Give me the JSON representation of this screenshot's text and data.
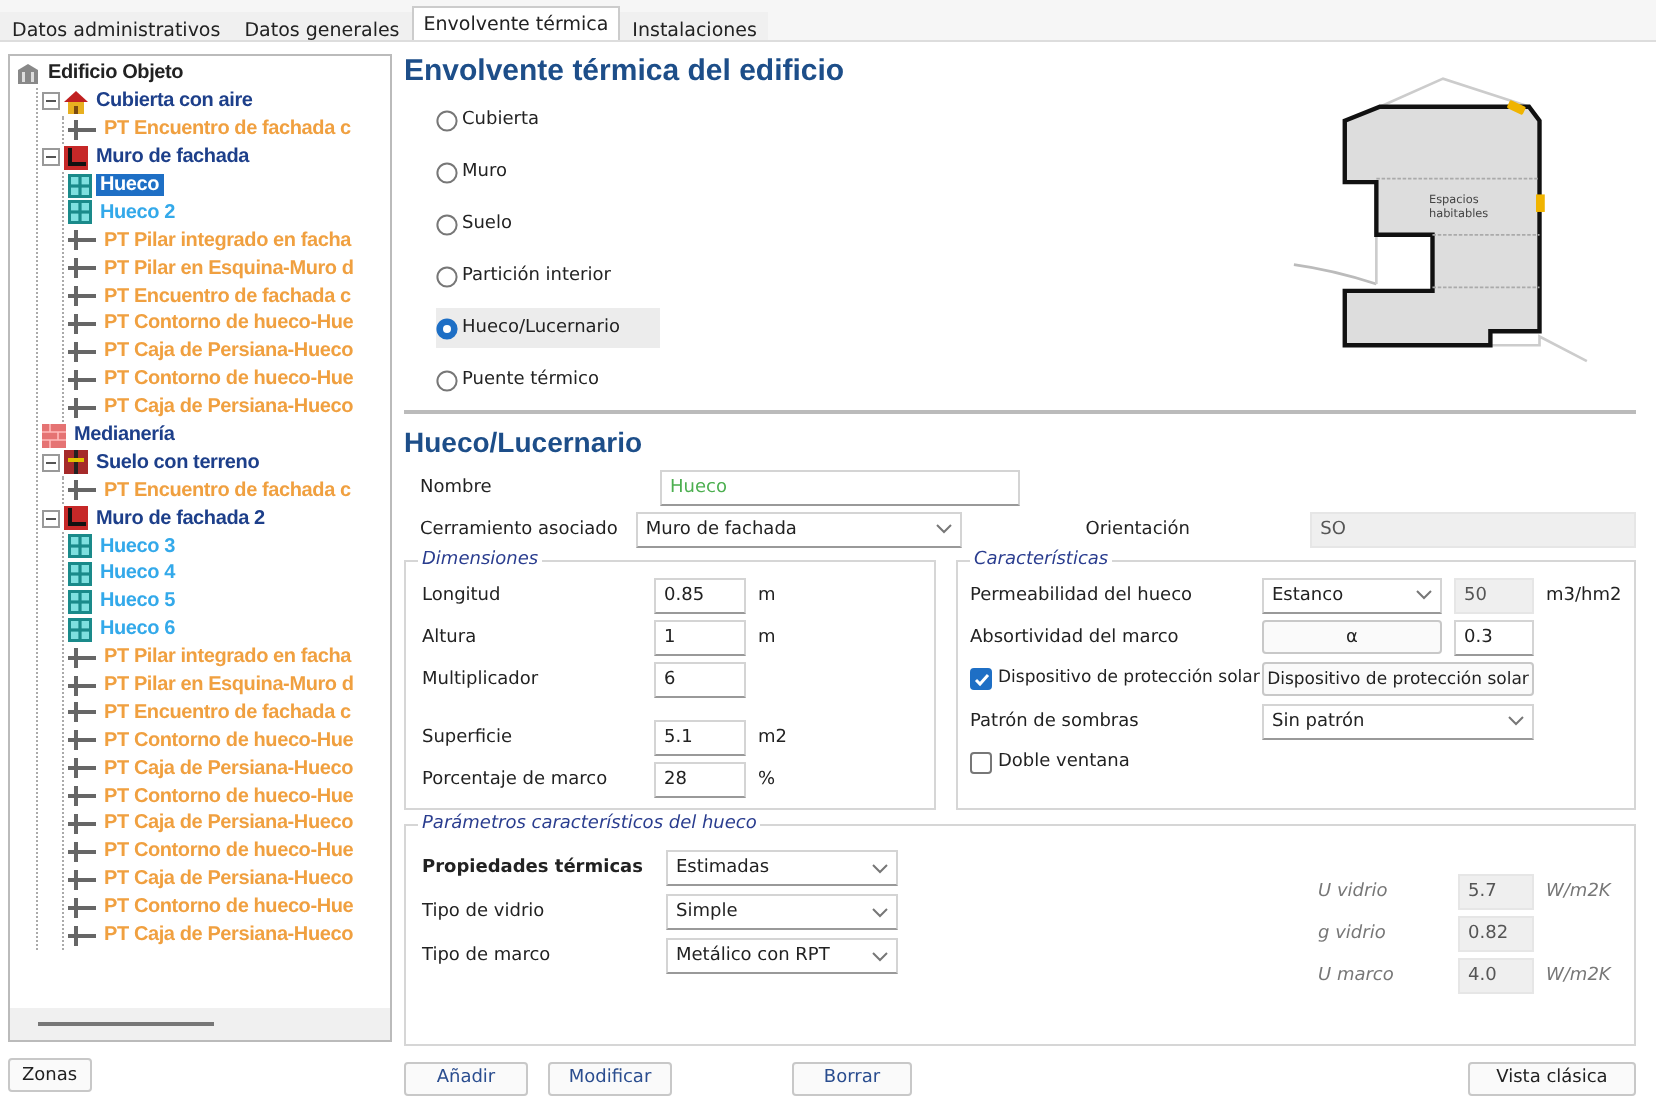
{
  "tabs": [
    {
      "label": "Datos administrativos",
      "selected": false
    },
    {
      "label": "Datos generales",
      "selected": false
    },
    {
      "label": "Envolvente térmica",
      "selected": true
    },
    {
      "label": "Instalaciones",
      "selected": false
    }
  ],
  "tree": [
    {
      "label": "Edificio Objeto",
      "kind": "building",
      "selected": false,
      "children": [
        {
          "label": "Cubierta con aire",
          "kind": "roof",
          "expanded": true,
          "selected": false,
          "children": [
            {
              "label": "PT Encuentro de fachada c",
              "kind": "bridge",
              "selected": false
            }
          ]
        },
        {
          "label": "Muro de fachada",
          "kind": "wall",
          "expanded": true,
          "selected": false,
          "children": [
            {
              "label": "Hueco",
              "kind": "window",
              "selected": true
            },
            {
              "label": "Hueco 2",
              "kind": "window",
              "selected": false
            },
            {
              "label": "PT Pilar integrado en facha",
              "kind": "bridge",
              "selected": false
            },
            {
              "label": "PT Pilar en Esquina-Muro d",
              "kind": "bridge",
              "selected": false
            },
            {
              "label": "PT Encuentro de fachada c",
              "kind": "bridge",
              "selected": false
            },
            {
              "label": "PT Contorno de hueco-Hue",
              "kind": "bridge",
              "selected": false
            },
            {
              "label": "PT Caja de Persiana-Hueco",
              "kind": "bridge",
              "selected": false
            },
            {
              "label": "PT Contorno de hueco-Hue",
              "kind": "bridge",
              "selected": false
            },
            {
              "label": "PT Caja de Persiana-Hueco",
              "kind": "bridge",
              "selected": false
            }
          ]
        },
        {
          "label": "Medianería",
          "kind": "party",
          "selected": false
        },
        {
          "label": "Suelo con terreno",
          "kind": "floor",
          "expanded": true,
          "selected": false,
          "children": [
            {
              "label": "PT Encuentro de fachada c",
              "kind": "bridge",
              "selected": false
            }
          ]
        },
        {
          "label": "Muro de fachada 2",
          "kind": "wall",
          "expanded": true,
          "selected": false,
          "children": [
            {
              "label": "Hueco 3",
              "kind": "window",
              "selected": false
            },
            {
              "label": "Hueco 4",
              "kind": "window",
              "selected": false
            },
            {
              "label": "Hueco 5",
              "kind": "window",
              "selected": false
            },
            {
              "label": "Hueco 6",
              "kind": "window",
              "selected": false
            },
            {
              "label": "PT Pilar integrado en facha",
              "kind": "bridge",
              "selected": false
            },
            {
              "label": "PT Pilar en Esquina-Muro d",
              "kind": "bridge",
              "selected": false
            },
            {
              "label": "PT Encuentro de fachada c",
              "kind": "bridge",
              "selected": false
            },
            {
              "label": "PT Contorno de hueco-Hue",
              "kind": "bridge",
              "selected": false
            },
            {
              "label": "PT Caja de Persiana-Hueco",
              "kind": "bridge",
              "selected": false
            },
            {
              "label": "PT Contorno de hueco-Hue",
              "kind": "bridge",
              "selected": false
            },
            {
              "label": "PT Caja de Persiana-Hueco",
              "kind": "bridge",
              "selected": false
            },
            {
              "label": "PT Contorno de hueco-Hue",
              "kind": "bridge",
              "selected": false
            },
            {
              "label": "PT Caja de Persiana-Hueco",
              "kind": "bridge",
              "selected": false
            },
            {
              "label": "PT Contorno de hueco-Hue",
              "kind": "bridge",
              "selected": false
            },
            {
              "label": "PT Caja de Persiana-Hueco",
              "kind": "bridge",
              "selected": false
            }
          ]
        }
      ]
    }
  ],
  "zones_button": "Zonas",
  "title": "Envolvente térmica del edificio",
  "element_types": [
    {
      "label": "Cubierta",
      "selected": false
    },
    {
      "label": "Muro",
      "selected": false
    },
    {
      "label": "Suelo",
      "selected": false
    },
    {
      "label": "Partición interior",
      "selected": false
    },
    {
      "label": "Hueco/Lucernario",
      "selected": true
    },
    {
      "label": "Puente térmico",
      "selected": false
    }
  ],
  "diagram_label": [
    "Espacios",
    "habitables"
  ],
  "section_title": "Hueco/Lucernario",
  "name": {
    "label": "Nombre",
    "value": "Hueco"
  },
  "enclosure": {
    "label": "Cerramiento asociado",
    "value": "Muro de fachada"
  },
  "orientation": {
    "label": "Orientación",
    "value": "SO"
  },
  "dimensions": {
    "title": "Dimensiones",
    "rows": [
      {
        "label": "Longitud",
        "value": "0.85",
        "unit": "m"
      },
      {
        "label": "Altura",
        "value": "1",
        "unit": "m"
      },
      {
        "label": "Multiplicador",
        "value": "6"
      },
      {
        "label": "Superficie",
        "value": "5.1",
        "unit": "m2"
      },
      {
        "label": "Porcentaje de marco",
        "value": "28",
        "unit": "%"
      }
    ]
  },
  "characteristics": {
    "title": "Características",
    "permeability": {
      "label": "Permeabilidad del hueco",
      "value": "Estanco",
      "reading": "50",
      "unit": "m3/hm2"
    },
    "absorptivity": {
      "label": "Absortividad del marco",
      "button": "α",
      "value": "0.3"
    },
    "solar_protection": {
      "label": "Dispositivo de protección solar",
      "checked": true,
      "button": "Dispositivo de protección solar"
    },
    "shadow_pattern": {
      "label": "Patrón de sombras",
      "value": "Sin patrón"
    },
    "double_window": {
      "label": "Doble ventana",
      "checked": false
    }
  },
  "parameters": {
    "title": "Parámetros característicos del hueco",
    "selects": [
      {
        "label": "Propiedades térmicas",
        "bold": true,
        "value": "Estimadas"
      },
      {
        "label": "Tipo de vidrio",
        "bold": false,
        "value": "Simple"
      },
      {
        "label": "Tipo de marco",
        "bold": false,
        "value": "Metálico con RPT"
      }
    ],
    "readings": [
      {
        "label": "U vidrio",
        "value": "5.7",
        "unit": "W/m2K"
      },
      {
        "label": "g vidrio",
        "value": "0.82"
      },
      {
        "label": "U marco",
        "value": "4.0",
        "unit": "W/m2K"
      }
    ]
  },
  "actions": [
    "Añadir",
    "Modificar",
    "Borrar"
  ],
  "classic_view": "Vista clásica"
}
